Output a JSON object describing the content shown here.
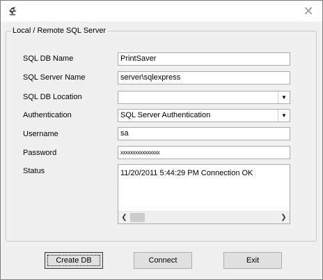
{
  "window": {
    "icon": "app-icon",
    "close_icon": "close-icon"
  },
  "group": {
    "title": "Local / Remote SQL Server"
  },
  "form": {
    "db_name_label": "SQL DB Name",
    "db_name_value": "PrintSaver",
    "server_name_label": "SQL Server Name",
    "server_name_value": "server\\sqlexpress",
    "db_location_label": "SQL DB Location",
    "db_location_value": "",
    "authentication_label": "Authentication",
    "authentication_value": "SQL Server Authentication",
    "username_label": "Username",
    "username_value": "sa",
    "password_label": "Password",
    "password_value": "xxxxxxxxxxxxxxxx",
    "status_label": "Status",
    "status_value": "11/20/2011 5:44:29 PM Connection OK"
  },
  "buttons": {
    "create_db": "Create DB",
    "connect": "Connect",
    "exit": "Exit"
  }
}
